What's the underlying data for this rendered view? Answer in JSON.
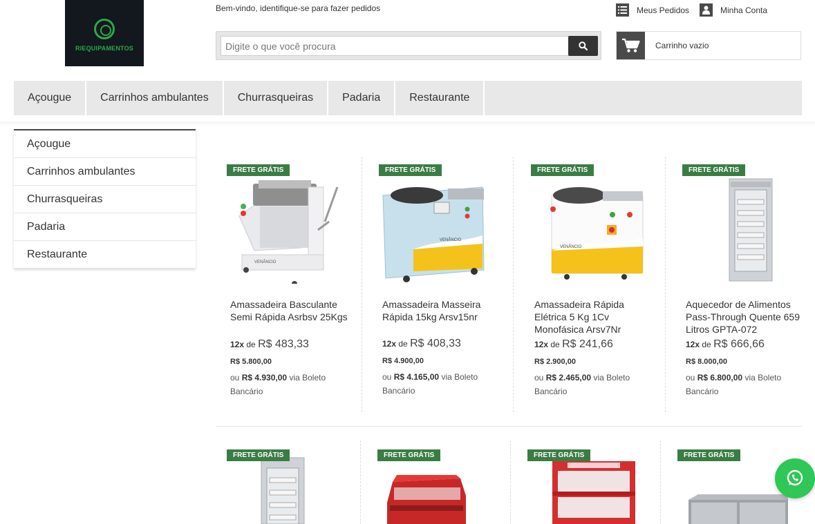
{
  "header": {
    "logo_text": "RIEQUIPAMENTOS",
    "welcome": "Bem-vindo, identifique-se para fazer pedidos",
    "search_placeholder": "Digite o que você procura",
    "orders_label": "Meus Pedidos",
    "account_label": "Minha Conta",
    "cart_label": "Carrinho vazio"
  },
  "nav": {
    "items": [
      "Açougue",
      "Carrinhos ambulantes",
      "Churrasqueiras",
      "Padaria",
      "Restaurante"
    ]
  },
  "sidebar": {
    "items": [
      "Açougue",
      "Carrinhos ambulantes",
      "Churrasqueiras",
      "Padaria",
      "Restaurante"
    ]
  },
  "products": [
    {
      "badge": "FRETE GRÁTIS",
      "name": "Amassadeira Basculante Semi Rápida Asrbsv 25Kgs",
      "inst_count": "12x",
      "inst_de": "de",
      "inst_value": "R$ 483,33",
      "price": "R$ 5.800,00",
      "boleto_pre": "ou",
      "boleto_price": "R$ 4.930,00",
      "boleto_post": "via Boleto Bancário"
    },
    {
      "badge": "FRETE GRÁTIS",
      "name": "Amassadeira Masseira Rápida 15kg Arsv15nr",
      "inst_count": "12x",
      "inst_de": "de",
      "inst_value": "R$ 408,33",
      "price": "R$ 4.900,00",
      "boleto_pre": "ou",
      "boleto_price": "R$ 4.165,00",
      "boleto_post": "via Boleto Bancário"
    },
    {
      "badge": "FRETE GRÁTIS",
      "name": "Amassadeira Rápida Elétrica 5 Kg 1Cv Monofásica Arsv7Nr",
      "inst_count": "12x",
      "inst_de": "de",
      "inst_value": "R$ 241,66",
      "price": "R$ 2.900,00",
      "boleto_pre": "ou",
      "boleto_price": "R$ 2.465,00",
      "boleto_post": "via Boleto Bancário"
    },
    {
      "badge": "FRETE GRÁTIS",
      "name": "Aquecedor de Alimentos Pass-Through Quente 659 Litros GPTA-072",
      "inst_count": "12x",
      "inst_de": "de",
      "inst_value": "R$ 666,66",
      "price": "R$ 8.000,00",
      "boleto_pre": "ou",
      "boleto_price": "R$ 6.800,00",
      "boleto_post": "via Boleto Bancário"
    }
  ],
  "products_row2": [
    {
      "badge": "FRETE GRÁTIS"
    },
    {
      "badge": "FRETE GRÁTIS"
    },
    {
      "badge": "FRETE GRÁTIS"
    },
    {
      "badge": "FRETE GRÁTIS"
    }
  ],
  "icons": {
    "search": "search-icon",
    "orders": "list-icon",
    "account": "user-icon",
    "cart": "cart-icon",
    "whatsapp": "whatsapp-icon"
  },
  "colors": {
    "badge": "#3a7d44",
    "whatsapp": "#2fc755",
    "logo_bg": "#12181d",
    "logo_green": "#2fa54b"
  }
}
